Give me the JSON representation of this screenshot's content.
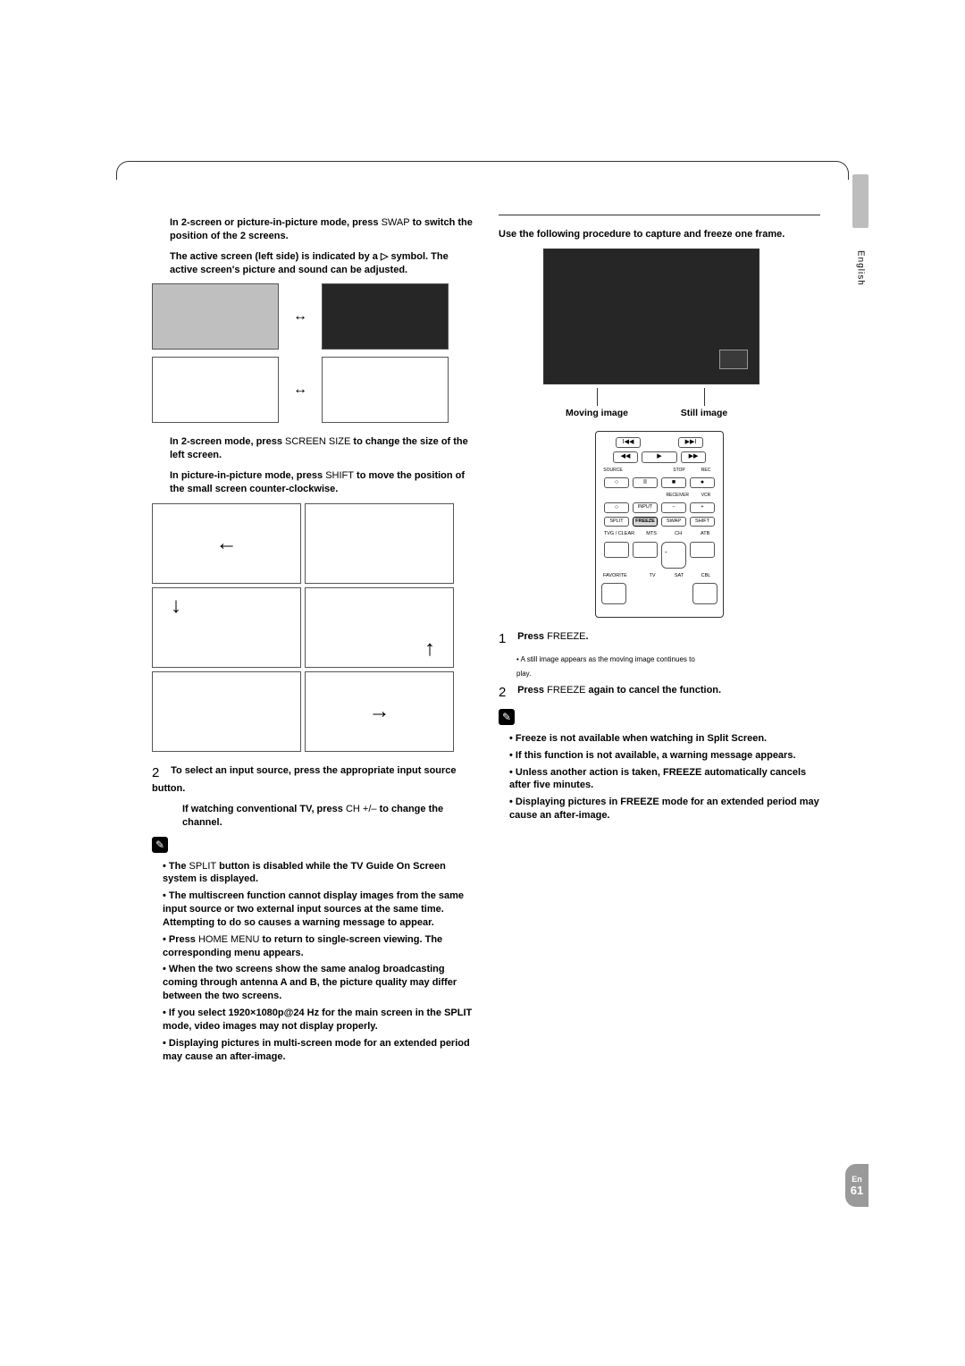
{
  "sidebar": {
    "language": "English"
  },
  "col_l": {
    "swap_heading_1": "In 2-screen or picture-in-picture mode, press ",
    "swap_button": "SWAP",
    "swap_heading_2": " to switch the position of the 2 screens.",
    "active_screen_1": "The active screen (left side) is indicated by a  ",
    "active_symbol": "▷",
    "active_screen_2": " symbol. The active screen's picture and sound can be adjusted.",
    "screen_size_1": "In 2-screen mode, press ",
    "screen_size_btn": "SCREEN SIZE",
    "screen_size_2": " to change the size of the left screen.",
    "shift_1": "In picture-in-picture mode, press ",
    "shift_btn": "SHIFT",
    "shift_2": " to move the position of the small screen counter-clockwise.",
    "step2_num": "2",
    "step2_text": "To select an input source, press the appropriate input source button.",
    "step2_bullet_1a": "If watching conventional TV, press ",
    "step2_ch": "CH +/–",
    "step2_bullet_1b": " to change the channel.",
    "note_1a": "The ",
    "note_split": "SPLIT",
    "note_1b": " button is disabled while the TV Guide On Screen system is displayed.",
    "note_2": "The multiscreen function cannot display images from the same input source or two external input sources at the same time. Attempting to do so causes a warning message to appear.",
    "note_3a": "Press ",
    "note_home": "HOME MENU",
    "note_3b": " to return to single-screen viewing. The corresponding menu appears.",
    "note_4": "When the two screens show the same analog broadcasting coming through antenna A and B, the picture quality may differ between the two screens.",
    "note_5": "If you select 1920×1080p@24 Hz for the main screen in the SPLIT mode, video images may not display properly.",
    "note_6": "Displaying pictures in multi-screen mode for an extended period may cause an after-image."
  },
  "col_r": {
    "freeze_intro": "Use the following procedure to capture and freeze one frame.",
    "label_moving": "Moving image",
    "label_still": "Still image",
    "step1_num": "1",
    "step1_text_a": "Press ",
    "step1_freeze": "FREEZE",
    "step1_text_b": ".",
    "step1_sub1": "• A still image appears as the moving image continues to",
    "step1_sub2": "play.",
    "step2_num": "2",
    "step2_text_a": "Press ",
    "step2_freeze": "FREEZE",
    "step2_text_b": " again to cancel the function.",
    "note_1": "Freeze is not available when watching in Split Screen.",
    "note_2": "If this function is not available, a warning message appears.",
    "note_3": "Unless another action is taken, FREEZE automatically cancels after five minutes.",
    "note_4": "Displaying pictures in FREEZE mode for an extended period may cause an after-image."
  },
  "remote": {
    "prev": "I◀◀",
    "next": "▶▶I",
    "rew": "◀◀",
    "play": "▶",
    "fwd": "▶▶",
    "source": "SOURCE",
    "stop": "STOP",
    "pause_g": "II",
    "rec": "REC",
    "circle": "○",
    "pause": "II",
    "stop2": "■",
    "dot": "●",
    "receiver": "RECEIVER",
    "vcr": "VCR",
    "input": "INPUT",
    "minus": "−",
    "plus": "+",
    "split": "SPLIT",
    "freeze": "FREEZE",
    "swap": "SWAP",
    "shift": "SHIFT",
    "tvg_clear": "TVG / CLEAR",
    "mts": "MTS",
    "ch": "CH",
    "atb": "ATB",
    "favorite": "FAVORITE",
    "tv": "TV",
    "sat": "SAT",
    "cbl": "CBL"
  },
  "footer": {
    "lang": "En",
    "page": "61"
  }
}
